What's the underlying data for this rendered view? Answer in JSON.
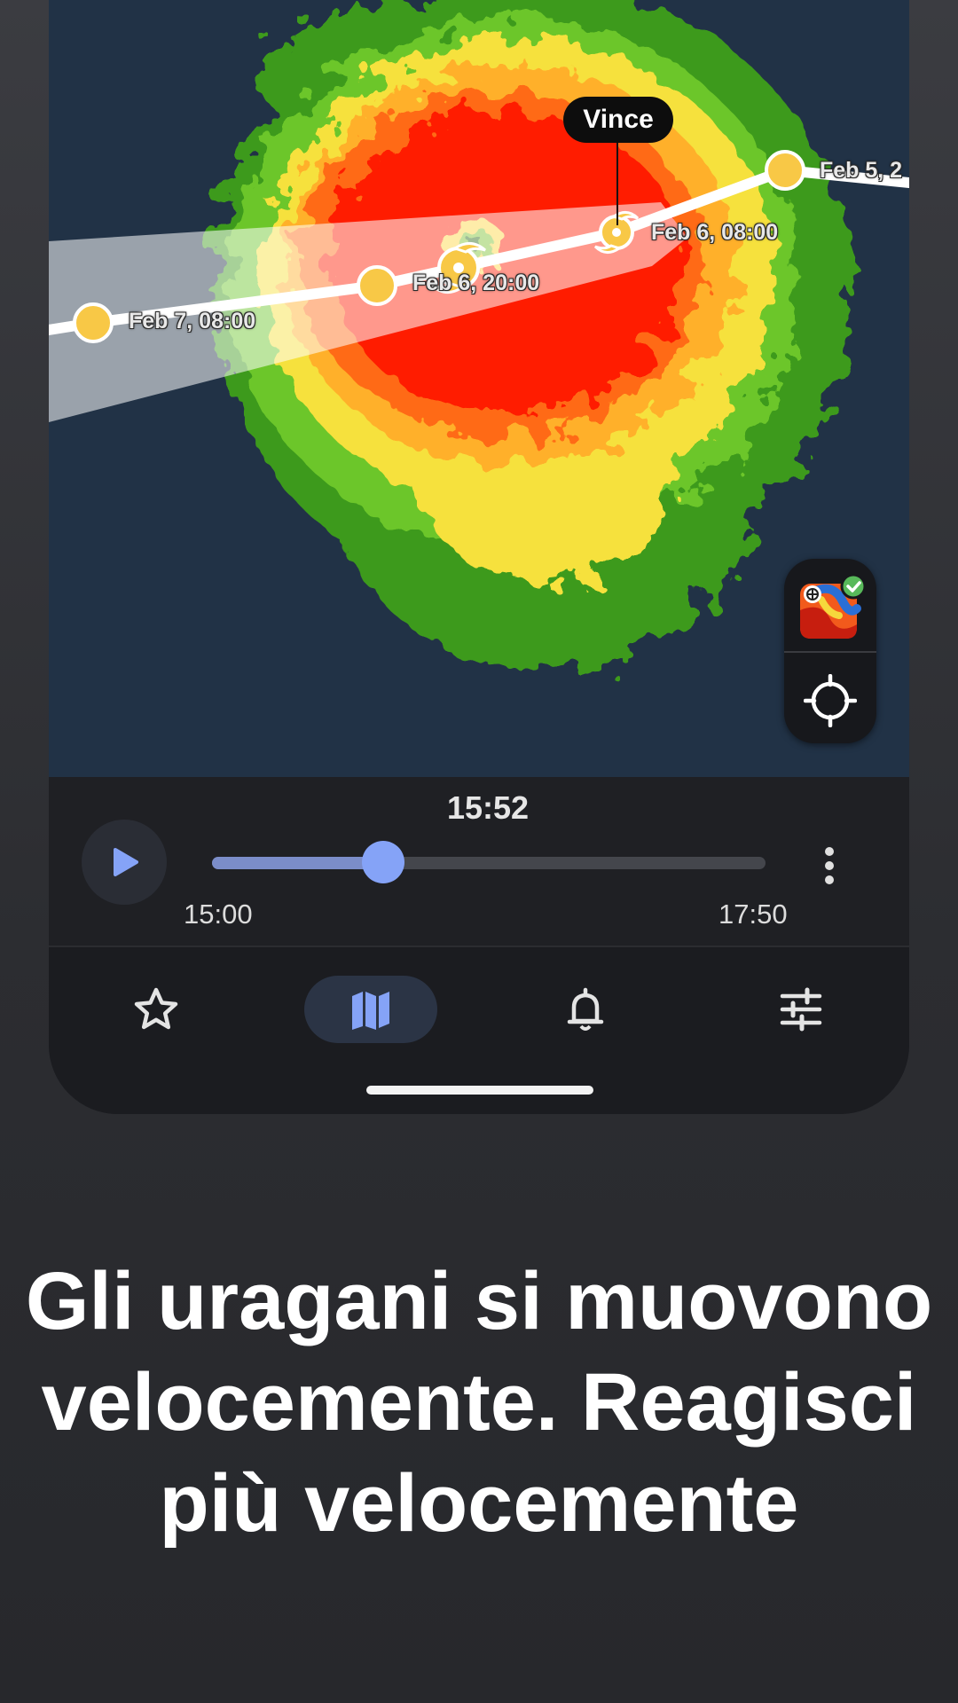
{
  "map": {
    "storm_name": "Vince",
    "track_points": [
      {
        "label": "Feb 7, 08:00"
      },
      {
        "label": "Feb 6, 20:00"
      },
      {
        "label": "Feb 6, 08:00"
      },
      {
        "label": "Feb 5, 2"
      }
    ]
  },
  "timeline": {
    "current_time": "15:52",
    "start_time": "15:00",
    "end_time": "17:50",
    "progress": 0.31
  },
  "nav": {
    "items": [
      {
        "name": "favorites",
        "icon": "star-icon"
      },
      {
        "name": "map",
        "icon": "map-icon",
        "active": true
      },
      {
        "name": "alerts",
        "icon": "bell-icon"
      },
      {
        "name": "settings",
        "icon": "sliders-icon"
      }
    ]
  },
  "headline": "Gli uragani si muovono velocemente. Reagisci più velocemente",
  "colors": {
    "map_background": "#213246",
    "radar_green": "#3f9a1c",
    "radar_yellow": "#f6d83c",
    "radar_orange": "#ff8a1e",
    "radar_red": "#ff1200",
    "track_point": "#f8c846",
    "accent": "#85a3f7"
  }
}
